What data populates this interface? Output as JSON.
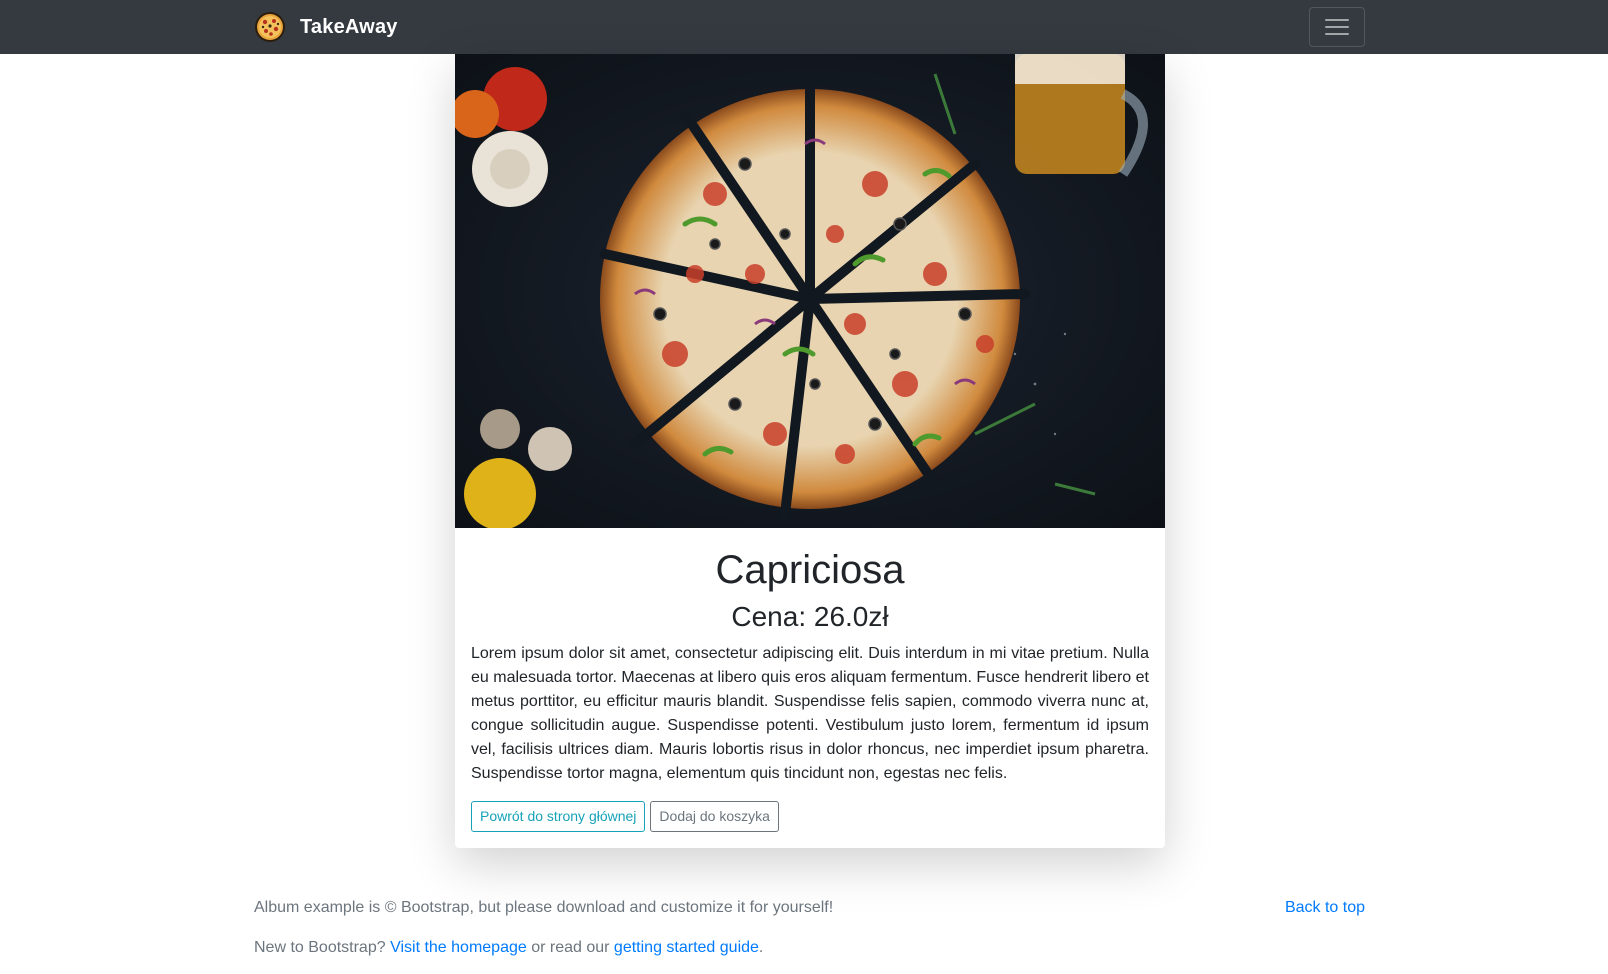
{
  "navbar": {
    "brand_name": "TakeAway",
    "logo_icon": "pizza-icon",
    "menu_icon": "hamburger-menu-icon"
  },
  "product": {
    "image_icon": "pizza-photo",
    "title": "Capriciosa",
    "price": "Cena: 26.0zł",
    "description": "Lorem ipsum dolor sit amet, consectetur adipiscing elit. Duis interdum in mi vitae pretium. Nulla eu malesuada tortor. Maecenas at libero quis eros aliquam fermentum. Fusce hendrerit libero et metus porttitor, eu efficitur mauris blandit. Suspendisse felis sapien, commodo viverra nunc at, congue sollicitudin augue. Suspendisse potenti. Vestibulum justo lorem, fermentum id ipsum vel, facilisis ultrices diam. Mauris lobortis risus in dolor rhoncus, nec imperdiet ipsum pharetra. Suspendisse tortor magna, elementum quis tincidunt non, egestas nec felis.",
    "back_button": "Powrót do strony głównej",
    "add_to_cart_button": "Dodaj do koszyka"
  },
  "footer": {
    "line1": "Album example is © Bootstrap, but please download and customize it for yourself!",
    "back_to_top": "Back to top",
    "line2_prefix": "New to Bootstrap? ",
    "homepage_link": "Visit the homepage",
    "line2_middle": " or read our ",
    "guide_link": "getting started guide",
    "line2_suffix": "."
  },
  "colors": {
    "navbar_bg": "#343a40",
    "link": "#007bff",
    "info": "#17a2b8",
    "secondary": "#6c757d"
  }
}
